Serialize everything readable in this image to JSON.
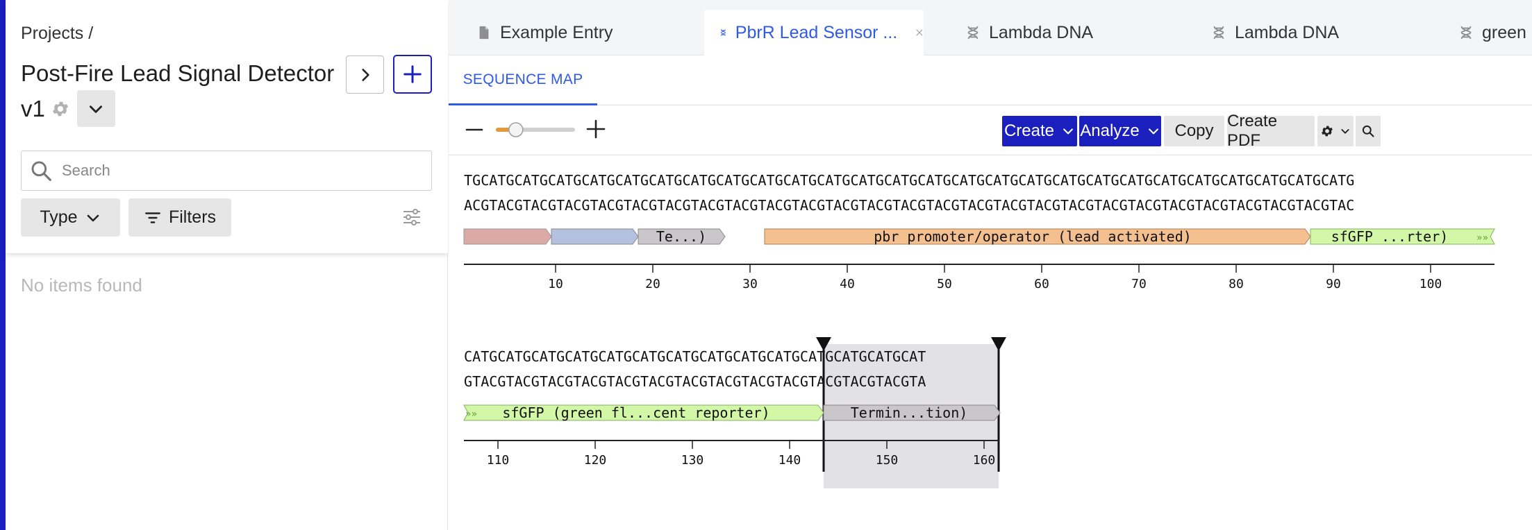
{
  "sidebar": {
    "breadcrumb": "Projects /",
    "project_title_line1": "Post-Fire Lead Signal Detector",
    "version": "v1",
    "search_placeholder": "Search",
    "type_label": "Type",
    "filters_label": "Filters",
    "empty_text": "No items found"
  },
  "tabs": [
    {
      "label": "Example Entry",
      "icon": "document-icon",
      "active": false
    },
    {
      "label": "PbrR Lead Sensor ...",
      "icon": "dna-icon",
      "active": true
    },
    {
      "label": "Lambda DNA",
      "icon": "dna-icon",
      "active": false
    },
    {
      "label": "Lambda DNA",
      "icon": "dna-icon",
      "active": false
    },
    {
      "label": "green",
      "icon": "dna-icon",
      "active": false
    }
  ],
  "subnav": {
    "sequence_map_label": "SEQUENCE MAP"
  },
  "toolbar": {
    "create_label": "Create",
    "analyze_label": "Analyze",
    "copy_label": "Copy",
    "create_pdf_label": "Create PDF",
    "zoom_level": 0.2
  },
  "sequence": {
    "row1_top": "TGCATGCATGCATGCATGCATGCATGCATGCATGCATGCATGCATGCATGCATGCATGCATGCATGCATGCATGCATGCATGCATGCATGCATGCATGCATGCATG",
    "row1_bottom": "ACGTACGTACGTACGTACGTACGTACGTACGTACGTACGTACGTACGTACGTACGTACGTACGTACGTACGTACGTACGTACGTACGTACGTACGTACGTACGTAC",
    "row2_top": "CATGCATGCATGCATGCATGCATGCATGCATGCATGCATGCATGCATGCATGCAT",
    "row2_bottom": "GTACGTACGTACGTACGTACGTACGTACGTACGTACGTACGTACGTACGTACGTA",
    "features_row1": [
      {
        "label": "",
        "color": "#dba9a6"
      },
      {
        "label": "",
        "color": "#b4c0e0"
      },
      {
        "label": "Te...)",
        "color": "#c9c7c9"
      },
      {
        "label": "pbr promoter/operator (lead activated)",
        "color": "#f4c08f"
      },
      {
        "label": "sfGFP ...rter)",
        "color": "#d2f7a7"
      }
    ],
    "features_row2": [
      {
        "label": "sfGFP (green fl...cent reporter)",
        "color": "#d2f7a7"
      },
      {
        "label": "Termin...tion)",
        "color": "#c9c7c9"
      }
    ],
    "ticks_row1": [
      "10",
      "20",
      "30",
      "40",
      "50",
      "60",
      "70",
      "80",
      "90",
      "100"
    ],
    "ticks_row2": [
      "110",
      "120",
      "130",
      "140",
      "150",
      "160"
    ]
  }
}
